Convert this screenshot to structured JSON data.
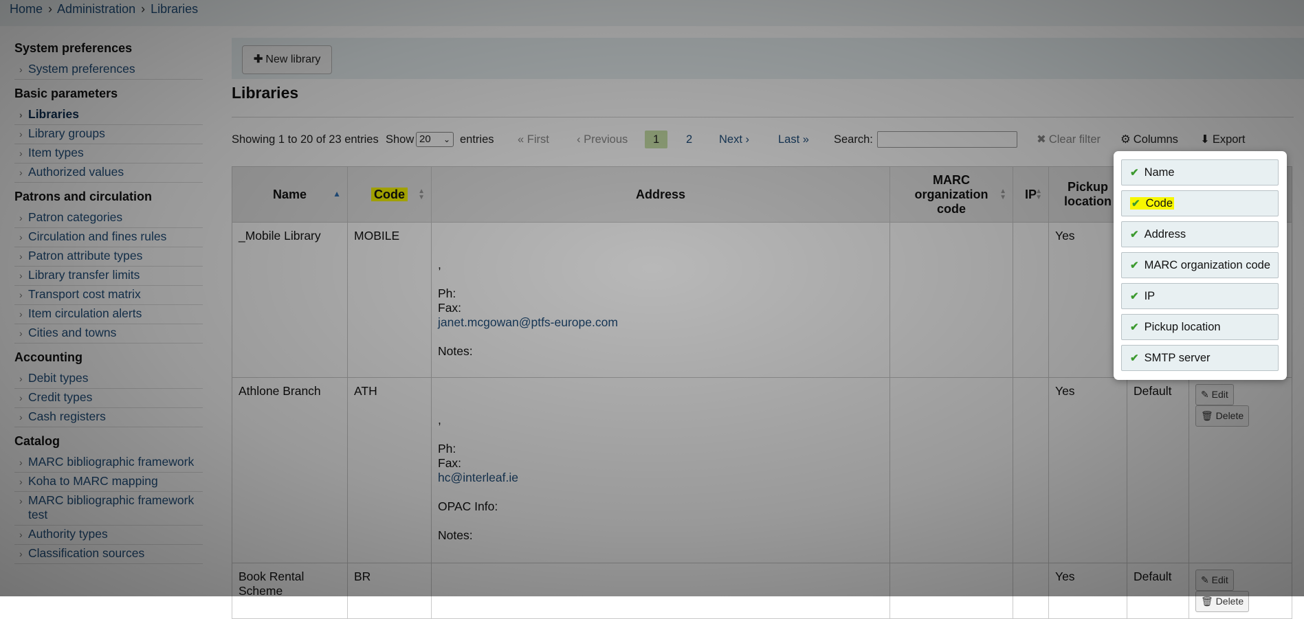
{
  "breadcrumb": {
    "home": "Home",
    "administration": "Administration",
    "current": "Libraries",
    "sep": "›"
  },
  "sidebar": {
    "system": {
      "heading": "System preferences",
      "items": [
        "System preferences"
      ]
    },
    "basic": {
      "heading": "Basic parameters",
      "items": [
        "Libraries",
        "Library groups",
        "Item types",
        "Authorized values"
      ]
    },
    "patrons": {
      "heading": "Patrons and circulation",
      "items": [
        "Patron categories",
        "Circulation and fines rules",
        "Patron attribute types",
        "Library transfer limits",
        "Transport cost matrix",
        "Item circulation alerts",
        "Cities and towns"
      ]
    },
    "accounting": {
      "heading": "Accounting",
      "items": [
        "Debit types",
        "Credit types",
        "Cash registers"
      ]
    },
    "catalog": {
      "heading": "Catalog",
      "items": [
        "MARC bibliographic framework",
        "Koha to MARC mapping",
        "MARC bibliographic framework test",
        "Authority types",
        "Classification sources"
      ]
    }
  },
  "toolbar": {
    "new_library": "New library"
  },
  "page_title": "Libraries",
  "controls": {
    "showing": "Showing 1 to 20 of 23 entries",
    "show": "Show",
    "page_size": "20",
    "entries": "entries",
    "first": "« First",
    "previous": "‹ Previous",
    "page1": "1",
    "page2": "2",
    "next": "Next ›",
    "last": "Last »",
    "search_label": "Search:",
    "search_value": "",
    "clear_filter": "Clear filter",
    "columns": "Columns",
    "export": "Export"
  },
  "table": {
    "headers": {
      "name": "Name",
      "code": "Code",
      "address": "Address",
      "marc_line1": "MARC",
      "marc_line2": "organization",
      "marc_line3": "code",
      "ip": "IP",
      "pickup_line1": "Pickup",
      "pickup_line2": "location"
    },
    "rows": [
      {
        "name": "_Mobile Library",
        "code": "MOBILE",
        "addr_comma": ",",
        "ph": "Ph:",
        "fax": "Fax:",
        "email": "janet.mcgowan@ptfs-europe.com",
        "notes": "Notes:",
        "pickup": "Yes"
      },
      {
        "name": "Athlone Branch",
        "code": "ATH",
        "addr_comma": ",",
        "ph": "Ph:",
        "fax": "Fax:",
        "email": "hc@interleaf.ie",
        "opac": "OPAC Info:",
        "notes": "Notes:",
        "pickup": "Yes",
        "smtp": "Default",
        "edit": "Edit",
        "delete": "Delete"
      },
      {
        "name": "Book Rental Scheme",
        "code": "BR",
        "pickup": "Yes",
        "smtp": "Default",
        "edit": "Edit",
        "delete": "Delete"
      }
    ]
  },
  "columns_popup": {
    "options": [
      "Name",
      "Code",
      "Address",
      "MARC organization code",
      "IP",
      "Pickup location",
      "SMTP server"
    ],
    "check_color": "#3c9a2f",
    "highlight_color": "#f7f700"
  }
}
